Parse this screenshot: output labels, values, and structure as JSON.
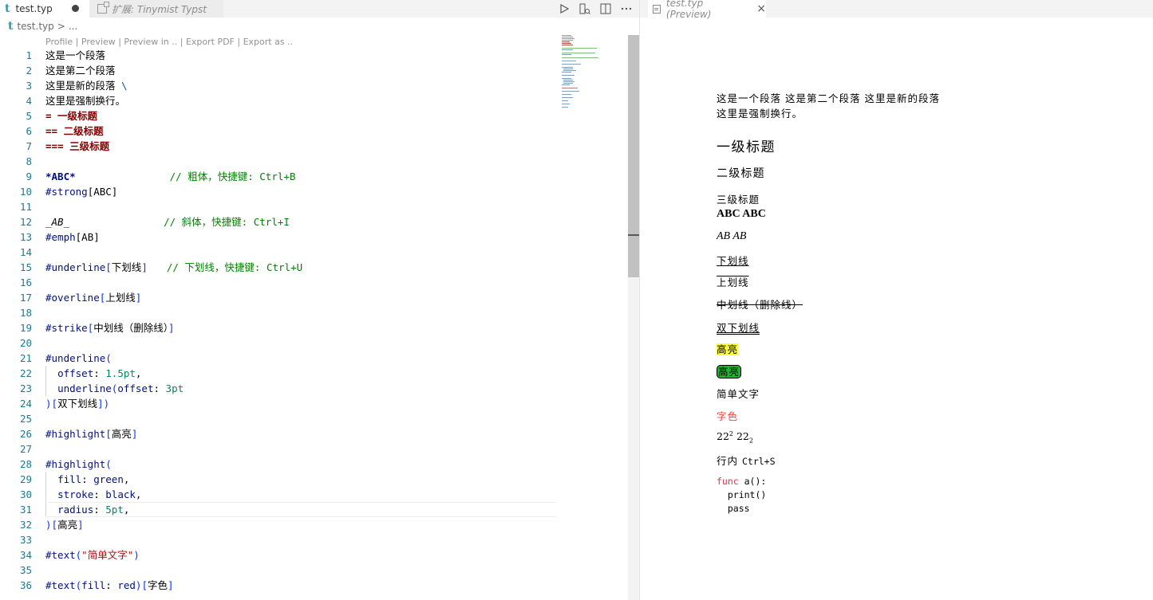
{
  "editor": {
    "tabs": [
      {
        "label": "test.typ",
        "icon": "typst-t-icon",
        "dirty": true
      },
      {
        "label": "扩展: Tinymist Typst",
        "icon": "extension-icon"
      }
    ],
    "breadcrumb": {
      "file": "test.typ",
      "sep": ">",
      "rest": "..."
    },
    "codelens": "Profile | Preview | Preview in .. | Export PDF | Export as ..",
    "line_numbers": [
      "1",
      "2",
      "3",
      "4",
      "5",
      "6",
      "7",
      "8",
      "9",
      "10",
      "11",
      "12",
      "13",
      "14",
      "15",
      "16",
      "17",
      "18",
      "19",
      "20",
      "21",
      "22",
      "23",
      "24",
      "25",
      "26",
      "27",
      "28",
      "29",
      "30",
      "31",
      "32",
      "33",
      "34",
      "35",
      "36"
    ],
    "lines": {
      "l1": "这是一个段落",
      "l2": "这是第二个段落",
      "l3a": "这里是新的段落 ",
      "l3b": "\\",
      "l4": "这里是强制换行。",
      "l5": "= 一级标题",
      "l6": "== 二级标题",
      "l7": "=== 三级标题",
      "l9a": "*ABC*",
      "l9b": "// 粗体，快捷键: Ctrl+B",
      "l10a": "#strong",
      "l10b": "[ABC]",
      "l12a": "_AB_",
      "l12b": "// 斜体，快捷键: Ctrl+I",
      "l13a": "#emph",
      "l13b": "[AB]",
      "l15a": "#underline",
      "l15b": "[",
      "l15c": "下划线",
      "l15d": "]",
      "l15e": "// 下划线，快捷键: Ctrl+U",
      "l17a": "#overline",
      "l17b": "[",
      "l17c": "上划线",
      "l17d": "]",
      "l19a": "#strike",
      "l19b": "[",
      "l19c": "中划线（删除线）",
      "l19d": "]",
      "l21a": "#underline",
      "l21b": "(",
      "l22a": "offset",
      "l22b": ": ",
      "l22c": "1.5pt",
      "l22d": ",",
      "l23a": "underline",
      "l23b": "(",
      "l23c": "offset",
      "l23d": ": ",
      "l23e": "3pt",
      "l24a": ")[",
      "l24b": "双下划线",
      "l24c": "])",
      "l26a": "#highlight",
      "l26b": "[",
      "l26c": "高亮",
      "l26d": "]",
      "l28a": "#highlight",
      "l28b": "(",
      "l29a": "fill",
      "l29b": ": ",
      "l29c": "green",
      "l29d": ",",
      "l30a": "stroke",
      "l30b": ": ",
      "l30c": "black",
      "l30d": ",",
      "l31a": "radius",
      "l31b": ": ",
      "l31c": "5pt",
      "l31d": ",",
      "l32a": ")[",
      "l32b": "高亮",
      "l32c": "]",
      "l34a": "#text",
      "l34b": "(",
      "l34c": "\"简单文字\"",
      "l34d": ")",
      "l36a": "#text",
      "l36b": "(",
      "l36c": "fill",
      "l36d": ": ",
      "l36e": "red",
      "l36f": ")[",
      "l36g": "字色",
      "l36h": "]"
    }
  },
  "preview": {
    "tab_label": "test.typ (Preview)",
    "close": "×",
    "para1": "这是一个段落 这是第二个段落 这里是新的段落",
    "para2": "这里是强制换行。",
    "h1": "一级标题",
    "h2": "二级标题",
    "h3": "三级标题",
    "bold": "ABC ABC",
    "italic": "AB AB",
    "underline": "下划线",
    "overline": "上划线",
    "strike": "中划线（删除线）",
    "double_underline": "双下划线",
    "highlight": "高亮",
    "highlight_green": "高亮",
    "simple_text": "简单文字",
    "red_text": "字色",
    "supsub_base1": "22",
    "sup": "2",
    "supsub_base2": " 22",
    "sub": "2",
    "inline_prefix": "行内 ",
    "inline_code": "Ctrl+S",
    "code_kw": "func",
    "code_l1": " a():",
    "code_l2": "  print()",
    "code_l3": "  pass"
  },
  "colors": {
    "heading": "#800000",
    "comment": "#008000",
    "keyword": "#0000ff",
    "highlight_yellow": "#fffd38",
    "highlight_green": "#22b22e",
    "red": "#ff4136"
  }
}
